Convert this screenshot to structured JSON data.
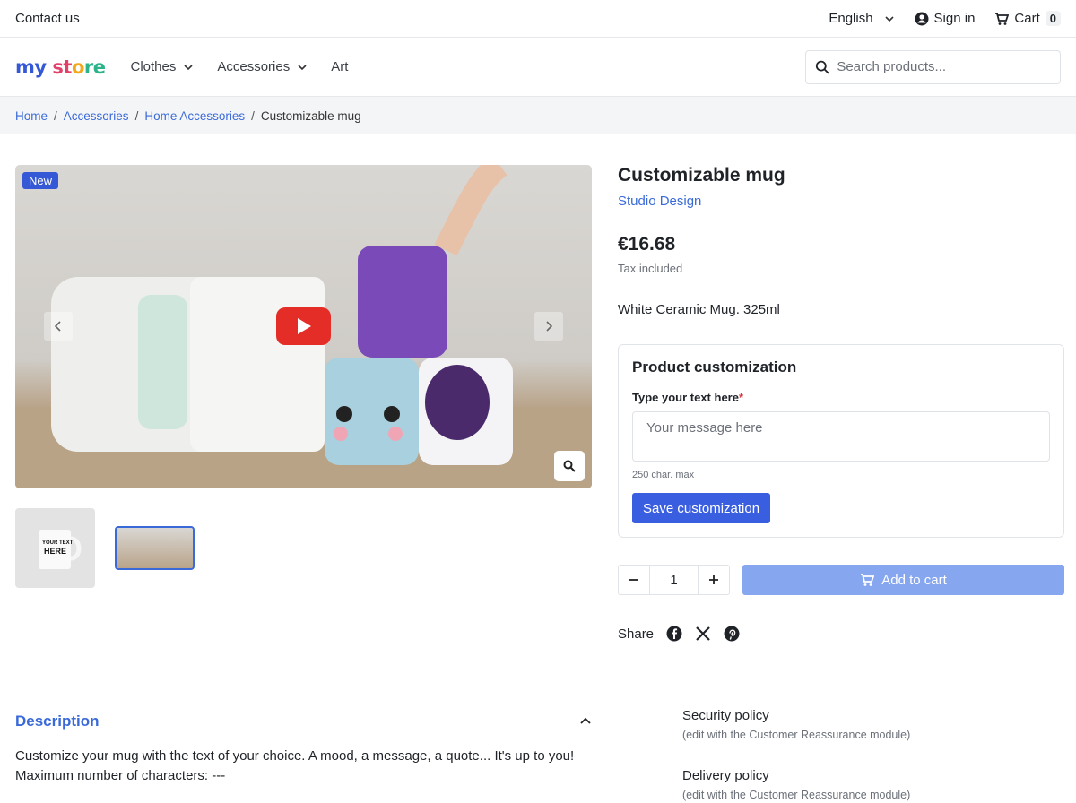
{
  "topbar": {
    "contact": "Contact us",
    "language": "English",
    "sign_in": "Sign in",
    "cart_label": "Cart",
    "cart_count": "0"
  },
  "header": {
    "logo": [
      "my",
      "st",
      "o",
      "re"
    ],
    "nav": [
      {
        "label": "Clothes",
        "has_dropdown": true
      },
      {
        "label": "Accessories",
        "has_dropdown": true
      },
      {
        "label": "Art",
        "has_dropdown": false
      }
    ],
    "search_placeholder": "Search products..."
  },
  "breadcrumb": {
    "items": [
      "Home",
      "Accessories",
      "Home Accessories"
    ],
    "current": "Customizable mug"
  },
  "gallery": {
    "badge": "New",
    "thumb_text": [
      "YOUR TEXT",
      "HERE"
    ]
  },
  "product": {
    "title": "Customizable mug",
    "brand": "Studio Design",
    "price": "€16.68",
    "tax": "Tax included",
    "short_description": "White Ceramic Mug. 325ml"
  },
  "customization": {
    "title": "Product customization",
    "label": "Type your text here",
    "required_mark": "*",
    "placeholder": "Your message here",
    "char_max": "250 char. max",
    "save_label": "Save customization"
  },
  "buy": {
    "quantity": "1",
    "add_to_cart": "Add to cart"
  },
  "share": {
    "label": "Share",
    "icons": [
      "facebook-icon",
      "x-icon",
      "pinterest-icon"
    ]
  },
  "description": {
    "title": "Description",
    "lines": [
      "Customize your mug with the text of your choice. A mood, a message, a quote... It's up to you!",
      "Maximum number of characters: ---"
    ]
  },
  "reassurance": [
    {
      "title": "Security policy",
      "subtitle": "(edit with the Customer Reassurance module)"
    },
    {
      "title": "Delivery policy",
      "subtitle": "(edit with the Customer Reassurance module)"
    }
  ],
  "colors": {
    "primary": "#3558d6",
    "link": "#3a6ad8",
    "add_to_cart_disabled": "#86a6f0"
  }
}
